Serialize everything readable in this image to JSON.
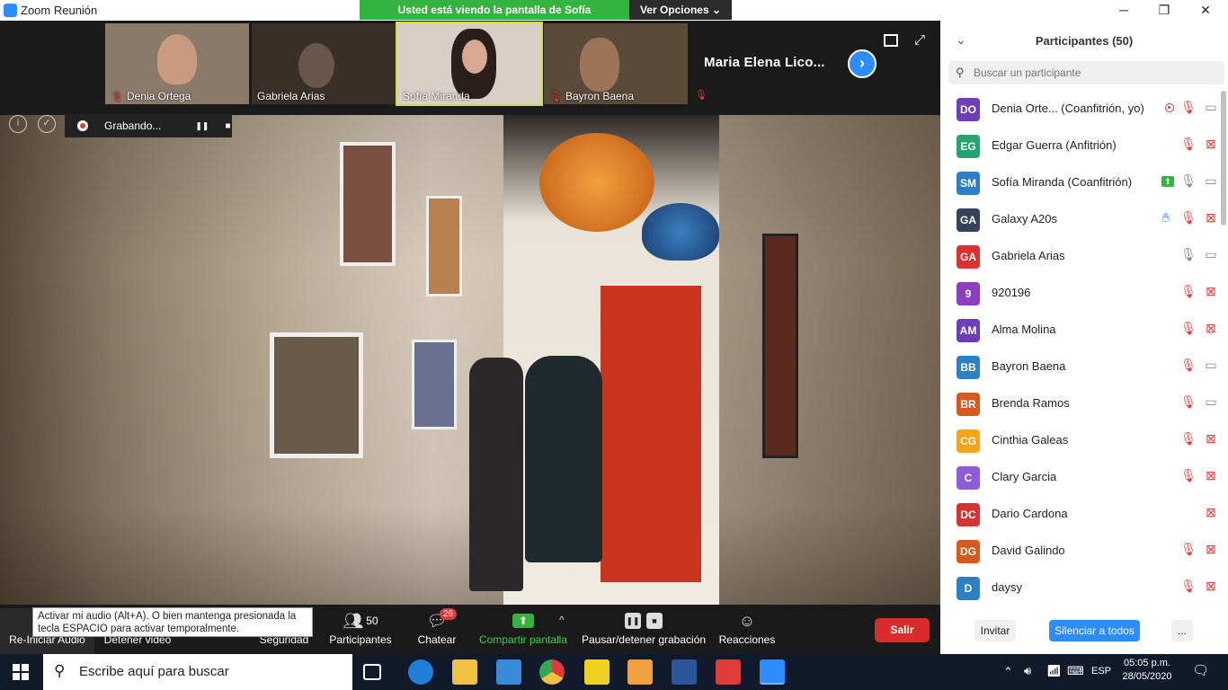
{
  "window": {
    "title": "Zoom Reunión",
    "minimize": "─",
    "maximize": "❐",
    "close": "✕"
  },
  "share_banner": {
    "message": "Usted está viendo la pantalla de Sofía Miranda",
    "options": "Ver Opciones",
    "options_chevron": "⌄"
  },
  "thumbnails": [
    {
      "name": "Denia Ortega",
      "muted": true,
      "bg": "#8a7a6a"
    },
    {
      "name": "Gabriela Arias",
      "muted": false,
      "bg": "#3a302a"
    },
    {
      "name": "Sofía Miranda",
      "muted": false,
      "bg": "#d8d0c8",
      "active": true
    },
    {
      "name": "Bayron Baena",
      "muted": true,
      "bg": "#5a4a38"
    }
  ],
  "strip_name": "Maria  Elena  Lico...",
  "strip_next_icon": "›",
  "recording": {
    "label": "Grabando...",
    "pause": "❚❚",
    "stop": "■",
    "info": "i",
    "shield": "✓"
  },
  "toolbar": {
    "audio_label": "Re-Iniciar Audio",
    "video_label": "Detener video",
    "security_label": "Seguridad",
    "participants_label": "Participantes",
    "participants_count": "50",
    "chat_label": "Chatear",
    "chat_badge": "26",
    "share_label": "Compartir pantalla",
    "share_chevron": "^",
    "record_label": "Pausar/detener grabación",
    "reactions_label": "Reacciones",
    "leave_label": "Salir",
    "tooltip": "Activar mi audio (Alt+A). O bien mantenga presionada la tecla ESPACIO para activar temporalmente."
  },
  "panel": {
    "title": "Participantes (50)",
    "collapse": "⌄",
    "search_placeholder": "Buscar un participante",
    "invite": "Invitar",
    "mute_all": "Silenciar a todos",
    "more": "..."
  },
  "participants": [
    {
      "initials": "DO",
      "name": "Denia Orte...  (Coanfitrión, yo)",
      "color": "#6e3db8",
      "icons": [
        "rec",
        "mic-off",
        "cam-on"
      ]
    },
    {
      "initials": "EG",
      "name": "Edgar Guerra (Anfitrión)",
      "color": "#26a36f",
      "icons": [
        "mic-off",
        "cam-off"
      ]
    },
    {
      "initials": "SM",
      "name": "Sofía Miranda (Coanfitrión)",
      "color": "#2d7fc4",
      "icons": [
        "share",
        "mic-on",
        "cam-on"
      ]
    },
    {
      "initials": "GA",
      "name": "Galaxy A20s",
      "color": "#33435a",
      "icons": [
        "hand",
        "mic-off",
        "cam-off"
      ]
    },
    {
      "initials": "GA",
      "name": "Gabriela Arias",
      "color": "#d83232",
      "icons": [
        "mic-on",
        "cam-on"
      ]
    },
    {
      "initials": "9",
      "name": "920196",
      "color": "#8e3dbe",
      "icons": [
        "mic-off",
        "cam-off"
      ]
    },
    {
      "initials": "AM",
      "name": "Alma Molina",
      "color": "#6e3db8",
      "icons": [
        "mic-off",
        "cam-off"
      ]
    },
    {
      "initials": "BB",
      "name": "Bayron Baena",
      "color": "#2d7fc4",
      "icons": [
        "mic-off",
        "cam-on"
      ]
    },
    {
      "initials": "BR",
      "name": "Brenda Ramos",
      "color": "#d45a1e",
      "icons": [
        "mic-off",
        "cam-on"
      ]
    },
    {
      "initials": "CG",
      "name": "Cinthia Galeas",
      "color": "#f2a51a",
      "icons": [
        "mic-off",
        "cam-off"
      ]
    },
    {
      "initials": "C",
      "name": "Clary Garcia",
      "color": "#8e5cd9",
      "icons": [
        "mic-off",
        "cam-off"
      ]
    },
    {
      "initials": "DC",
      "name": "Dario Cardona",
      "color": "#d83232",
      "icons": [
        "cam-off"
      ]
    },
    {
      "initials": "DG",
      "name": "David Galindo",
      "color": "#d45a1e",
      "icons": [
        "mic-off",
        "cam-off"
      ]
    },
    {
      "initials": "D",
      "name": "daysy",
      "color": "#2d7fc4",
      "icons": [
        "mic-off",
        "cam-off"
      ]
    }
  ],
  "taskbar": {
    "search_placeholder": "Escribe aquí para buscar",
    "language": "ESP",
    "time": "05:05 p.m.",
    "date": "28/05/2020"
  }
}
